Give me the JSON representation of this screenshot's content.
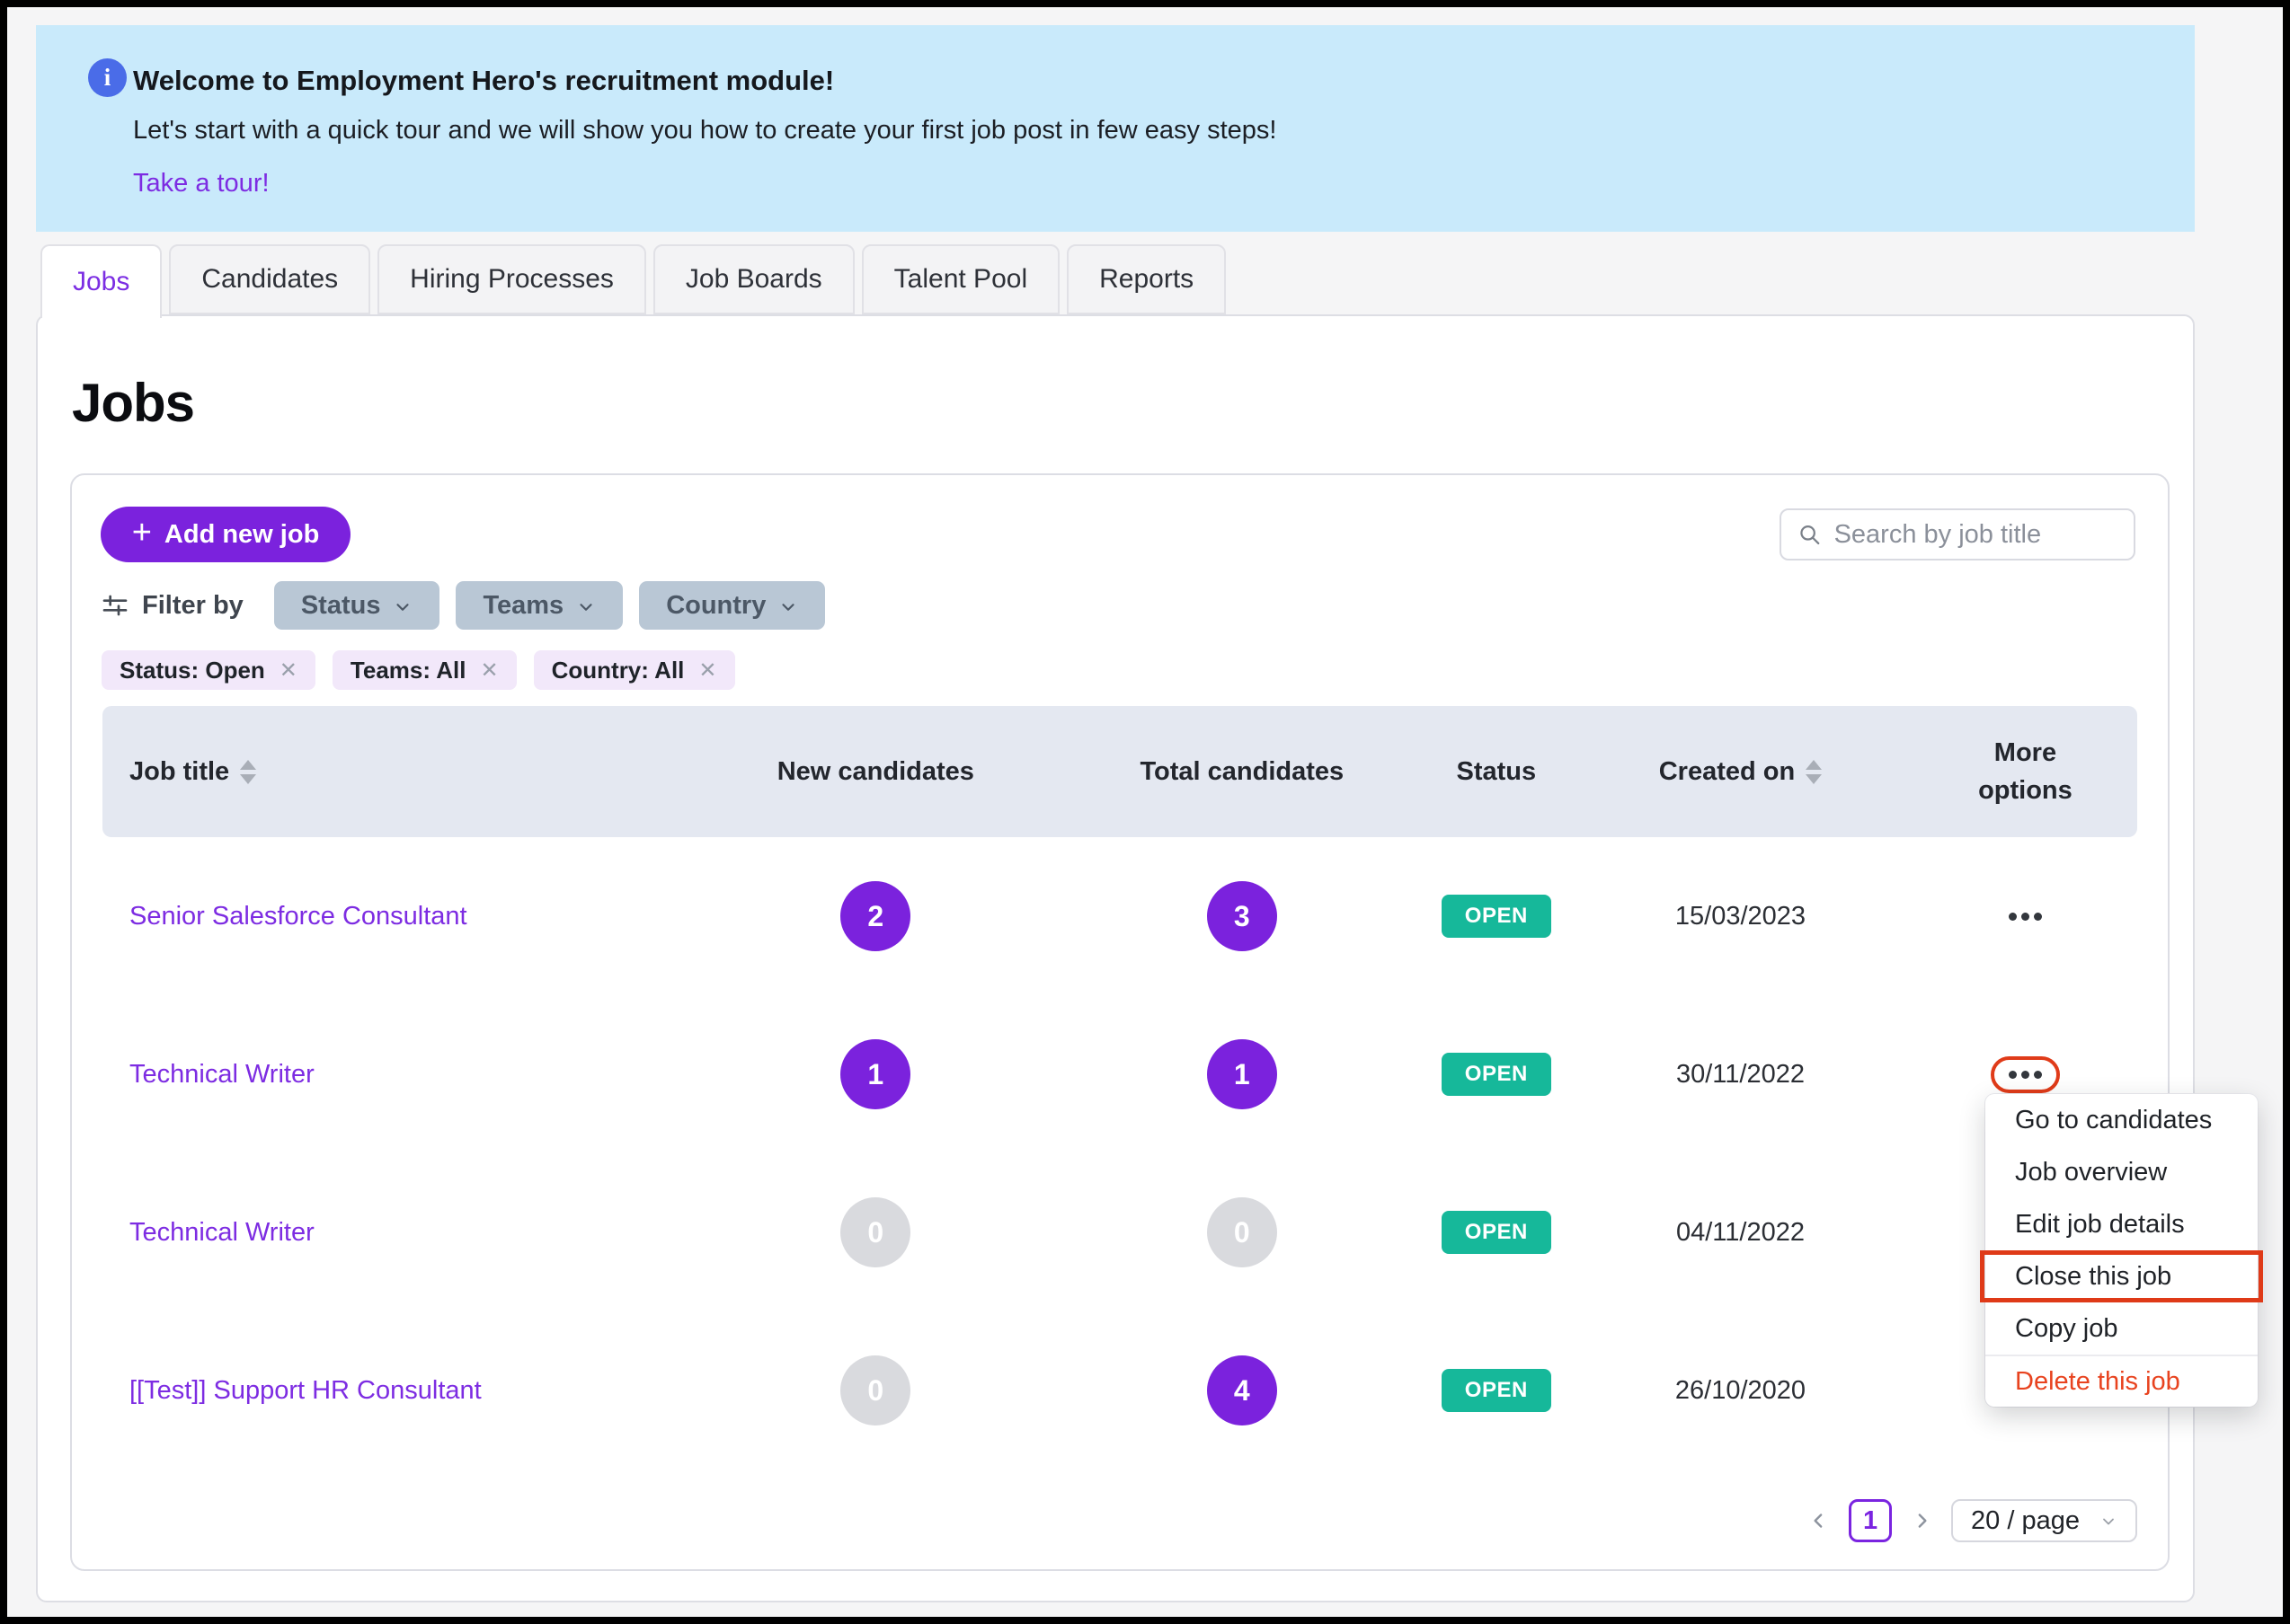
{
  "colors": {
    "brand_purple": "#7b22dd",
    "link_purple": "#7d2ce2",
    "status_teal": "#16b89a",
    "annotation_red": "#e03b19",
    "banner_blue": "#c9eafb",
    "info_icon_blue": "#4a6ce8",
    "filter_button_gray_blue": "#b9c7d5",
    "chip_lavender": "#f2e8fa",
    "table_header_bg": "#e4e8f1"
  },
  "banner": {
    "title": "Welcome to Employment Hero's recruitment module!",
    "body": "Let's start with a quick tour and we will show you how to create your first job post in few easy steps!",
    "link": "Take a tour!"
  },
  "tabs": [
    {
      "label": "Jobs",
      "active": true
    },
    {
      "label": "Candidates",
      "active": false
    },
    {
      "label": "Hiring Processes",
      "active": false
    },
    {
      "label": "Job Boards",
      "active": false
    },
    {
      "label": "Talent Pool",
      "active": false
    },
    {
      "label": "Reports",
      "active": false
    }
  ],
  "page_title": "Jobs",
  "toolbar": {
    "add_button": "Add new job",
    "search_placeholder": "Search by job title"
  },
  "filters": {
    "label": "Filter by",
    "dropdowns": [
      "Status",
      "Teams",
      "Country"
    ],
    "chips": [
      "Status: Open",
      "Teams: All",
      "Country: All"
    ]
  },
  "table": {
    "headers": {
      "job_title": "Job title",
      "new_candidates": "New candidates",
      "total_candidates": "Total candidates",
      "status": "Status",
      "created_on": "Created on",
      "more_options": "More options"
    },
    "rows": [
      {
        "title": "Senior Salesforce Consultant",
        "new": {
          "value": "2",
          "variant": "purple"
        },
        "total": {
          "value": "3",
          "variant": "purple"
        },
        "status": "OPEN",
        "created": "15/03/2023"
      },
      {
        "title": "Technical Writer",
        "new": {
          "value": "1",
          "variant": "purple"
        },
        "total": {
          "value": "1",
          "variant": "purple"
        },
        "status": "OPEN",
        "created": "30/11/2022",
        "more_options_highlighted": true
      },
      {
        "title": "Technical Writer",
        "new": {
          "value": "0",
          "variant": "gray"
        },
        "total": {
          "value": "0",
          "variant": "gray"
        },
        "status": "OPEN",
        "created": "04/11/2022"
      },
      {
        "title": "[[Test]] Support HR Consultant",
        "new": {
          "value": "0",
          "variant": "gray"
        },
        "total": {
          "value": "4",
          "variant": "purple"
        },
        "status": "OPEN",
        "created": "26/10/2020"
      }
    ]
  },
  "context_menu": {
    "items": [
      "Go to candidates",
      "Job overview",
      "Edit job details",
      "Close this job",
      "Copy job",
      "Delete this job"
    ],
    "highlighted_item": "Close this job",
    "danger_item": "Delete this job"
  },
  "pagination": {
    "current_page": "1",
    "page_size": "20 / page"
  }
}
